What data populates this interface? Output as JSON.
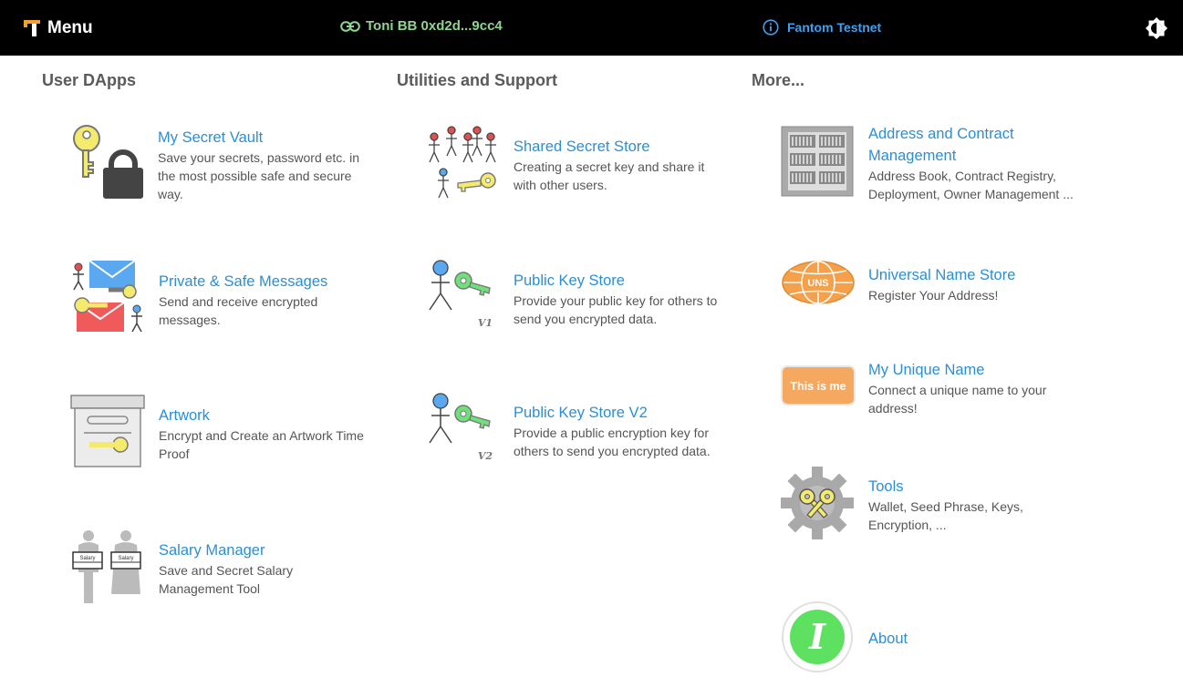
{
  "header": {
    "menu_label": "Menu",
    "account_label": "Toni BB 0xd2d...9cc4",
    "network_label": "Fantom Testnet",
    "icons": {
      "menu": "app-logo-icon",
      "account": "link-icon",
      "network": "info-icon",
      "theme": "brightness-icon"
    }
  },
  "sections": {
    "user_dapps": "User DApps",
    "utilities": "Utilities and Support",
    "more": "More..."
  },
  "items": {
    "secret_vault": {
      "title": "My Secret Vault",
      "desc": "Save your secrets, password etc. in the most possible safe and secure way."
    },
    "private_messages": {
      "title": "Private & Safe Messages",
      "desc": "Send and receive encrypted messages."
    },
    "artwork": {
      "title": "Artwork",
      "desc": "Encrypt and Create an Artwork Time Proof"
    },
    "salary_manager": {
      "title": "Salary Manager",
      "desc": "Save and Secret Salary Management Tool",
      "icon_badge": "Salary"
    },
    "shared_secret": {
      "title": "Shared Secret Store",
      "desc": "Creating a secret key and share it with other users."
    },
    "public_key_store": {
      "title": "Public Key Store",
      "desc": "Provide your public key for others to send you encrypted data.",
      "icon_badge": "V1"
    },
    "public_key_store_v2": {
      "title": "Public Key Store V2",
      "desc": "Provide a public encryption key for others to send you encrypted data.",
      "icon_badge": "V2"
    },
    "address_contract": {
      "title": "Address and Contract Management",
      "desc": "Address Book, Contract Registry, Deployment, Owner Management ..."
    },
    "universal_name": {
      "title": "Universal Name Store",
      "desc": "Register Your Address!",
      "icon_badge": "UNS"
    },
    "unique_name": {
      "title": "My Unique Name",
      "desc": "Connect a unique name to your address!",
      "icon_badge": "This is me"
    },
    "tools": {
      "title": "Tools",
      "desc": "Wallet, Seed Phrase, Keys, Encryption, ..."
    },
    "about": {
      "title": "About",
      "icon_badge": "I"
    }
  },
  "colors": {
    "header_bg": "#000000",
    "account": "#8fd48f",
    "network": "#3ea1f0",
    "link": "#2a8fd8",
    "section_title": "#5a5a5a",
    "description": "#555555"
  }
}
